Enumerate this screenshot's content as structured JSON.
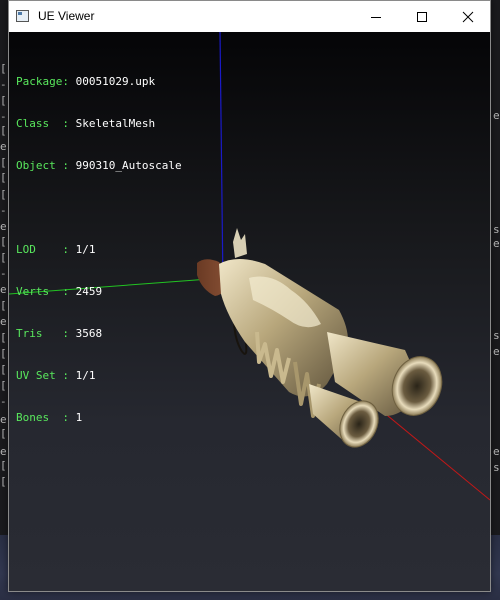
{
  "window": {
    "title": "UE Viewer",
    "controls": {
      "minimize": "—",
      "maximize": "☐",
      "close": "✕"
    }
  },
  "info": {
    "package": {
      "label": "Package:",
      "value": "00051029.upk"
    },
    "class": {
      "label": "Class  :",
      "value": "SkeletalMesh"
    },
    "object": {
      "label": "Object :",
      "value": "990310_Autoscale"
    },
    "lod": {
      "label": "LOD    :",
      "value": "1/1"
    },
    "verts": {
      "label": "Verts  :",
      "value": "2459"
    },
    "tris": {
      "label": "Tris   :",
      "value": "3568"
    },
    "uvset": {
      "label": "UV Set :",
      "value": "1/1"
    },
    "bones": {
      "label": "Bones  :",
      "value": "1"
    }
  },
  "colors": {
    "label_green": "#59e85d",
    "value_white": "#ffffff",
    "axis_x": "#c01818",
    "axis_y": "#22c322",
    "axis_z": "#1a1ac8"
  },
  "icons": {
    "app": "window-app-icon",
    "minimize": "minimize-icon",
    "maximize": "maximize-icon",
    "close": "close-icon"
  },
  "background": {
    "left_marks": [
      "[",
      "-",
      "[",
      "-",
      "[",
      "e",
      "[",
      "[",
      "[",
      "-",
      "e",
      "[",
      "[",
      "-",
      "e",
      "[",
      "e",
      "[",
      "[",
      "[",
      "[",
      "-",
      "e",
      "[",
      "e",
      "[",
      "["
    ],
    "right_marks": [
      "e",
      "s",
      "e",
      "s",
      "e",
      "e",
      "s"
    ]
  }
}
